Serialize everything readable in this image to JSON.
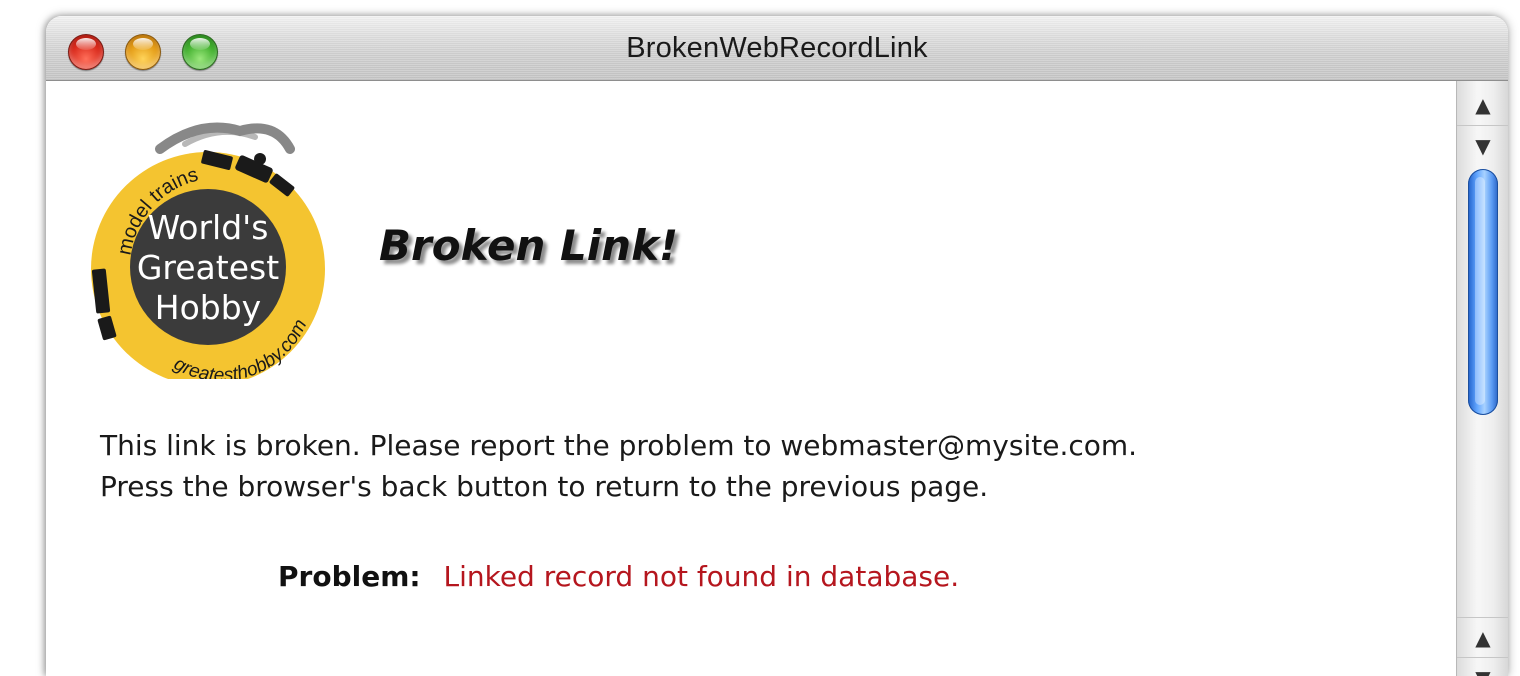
{
  "window": {
    "title": "BrokenWebRecordLink"
  },
  "logo": {
    "arc_top": "model trains",
    "line1": "World's",
    "line2": "Greatest",
    "line3": "Hobby",
    "arc_bottom": "greatesthobby.com"
  },
  "page": {
    "heading": "Broken Link!",
    "message_line1": "This link is broken. Please report the problem to webmaster@mysite.com.",
    "message_line2": "Press the browser's back button to return to the previous page.",
    "problem_label": "Problem:",
    "problem_value": "Linked record not found in database."
  },
  "scrollbar": {
    "up_glyph": "▲",
    "down_glyph": "▼"
  },
  "colors": {
    "logo_yellow": "#f4c430",
    "logo_dark": "#3b3b3b",
    "problem_red": "#b5161e",
    "thumb_blue": "#3a84f0"
  }
}
